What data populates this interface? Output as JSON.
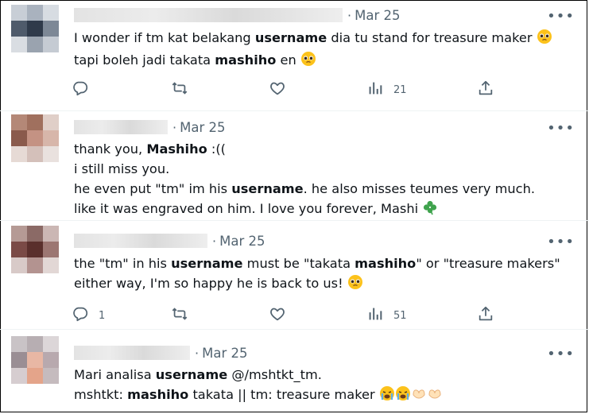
{
  "tweets": [
    {
      "date": "Mar 25",
      "separator": "·",
      "more": "•••",
      "lines": [
        [
          "I wonder if tm kat belakang ",
          {
            "b": "username"
          },
          " dia tu stand for treasure maker ",
          {
            "e": "pleading-face"
          }
        ],
        [
          "tapi boleh jadi takata ",
          {
            "b": "mashiho"
          },
          " en ",
          {
            "e": "pleading-face"
          }
        ]
      ],
      "actions": {
        "reply": "",
        "retweet": "",
        "like": "",
        "views": "21"
      }
    },
    {
      "date": "Mar 25",
      "separator": "·",
      "more": "•••",
      "lines": [
        [
          "thank you, ",
          {
            "b": "Mashiho"
          },
          " :(("
        ],
        [
          "i still miss you."
        ],
        [
          "he even put \"tm\" im his ",
          {
            "b": "username"
          },
          ". he also misses teumes very much."
        ],
        [
          "like it was engraved on him. I love you forever, Mashi ",
          {
            "e": "shamrock"
          }
        ]
      ]
    },
    {
      "date": "Mar 25",
      "separator": "·",
      "more": "•••",
      "lines": [
        [
          "the \"tm\" in his ",
          {
            "b": "username"
          },
          " must be \"takata ",
          {
            "b": "mashiho"
          },
          "\" or \"treasure makers\""
        ],
        [
          "either way, I'm so happy he is back to us! ",
          {
            "e": "pleading-face"
          }
        ]
      ],
      "actions": {
        "reply": "1",
        "retweet": "",
        "like": "",
        "views": "51"
      }
    },
    {
      "date": "Mar 25",
      "separator": "·",
      "more": "•••",
      "lines": [
        [
          "Mari analisa ",
          {
            "b": "username"
          },
          " @/mshtkt_tm."
        ],
        [
          "mshtkt: ",
          {
            "b": "mashiho"
          },
          " takata || tm: treasure maker ",
          {
            "e": "crying-face"
          },
          {
            "e": "crying-face"
          },
          {
            "e": "heart-hands"
          },
          {
            "e": "heart-hands"
          }
        ]
      ]
    }
  ],
  "icons": {
    "reply": "reply-icon",
    "retweet": "retweet-icon",
    "like": "like-icon",
    "views": "views-icon",
    "share": "share-icon"
  },
  "colors": {
    "text": "#0f1419",
    "muted": "#536471",
    "divider": "#eff3f4",
    "shamrock": "#3fa34d",
    "emoji_yellow": "#fcc21b"
  }
}
